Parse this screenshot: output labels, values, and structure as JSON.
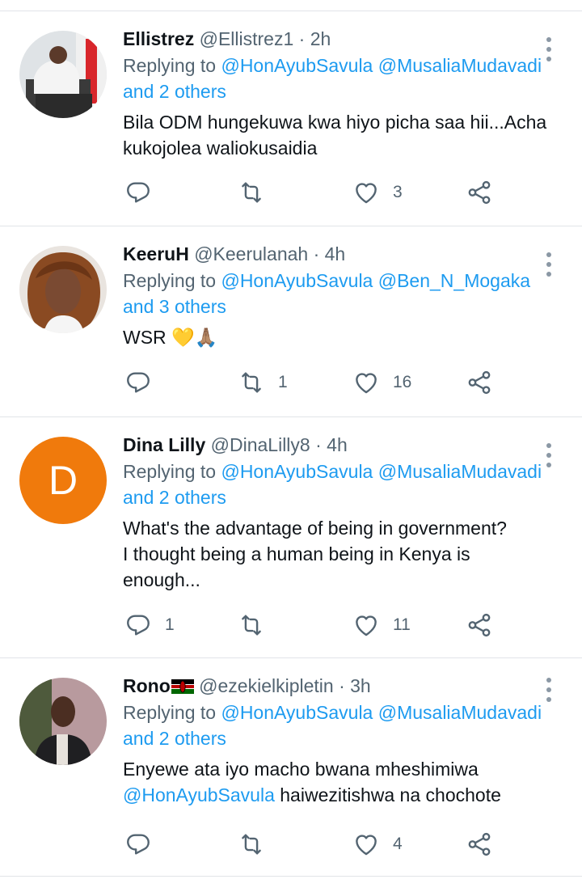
{
  "tweets": [
    {
      "name": "Ellistrez",
      "handle": "@Ellistrez1",
      "time": "· 2h",
      "reply_prefix": "Replying to",
      "mention1": "@HonAyubSavula",
      "mention2": "@MusaliaMudavadi",
      "others": "and 2 others",
      "text": "Bila ODM hungekuwa kwa hiyo picha saa hii...Acha kukojolea waliokusaidia",
      "replies": "",
      "retweets": "",
      "likes": "3"
    },
    {
      "name": "KeeruH",
      "handle": "@Keerulanah",
      "time": "· 4h",
      "reply_prefix": "Replying to",
      "mention1": "@HonAyubSavula",
      "mention2": "@Ben_N_Mogaka",
      "others": "and 3 others",
      "text": "WSR 💛🙏🏽",
      "replies": "",
      "retweets": "1",
      "likes": "16"
    },
    {
      "name": "Dina Lilly",
      "handle": "@DinaLilly8",
      "time": "· 4h",
      "avatar_letter": "D",
      "reply_prefix": "Replying to",
      "mention1": "@HonAyubSavula",
      "mention2": "@MusaliaMudavadi",
      "others": "and 2 others",
      "text_line1": "What's the advantage of being in government?",
      "text_line2": "I thought being a human being in Kenya is",
      "text_line3": "enough...",
      "replies": "1",
      "retweets": "",
      "likes": "11"
    },
    {
      "name": "Rono",
      "handle": "@ezekielkipletin",
      "time": "· 3h",
      "reply_prefix": "Replying to",
      "mention1": "@HonAyubSavula",
      "mention2": "@MusaliaMudavadi",
      "others": "and 2 others",
      "text_line1": "Enyewe ata iyo macho bwana mheshimiwa",
      "text_mention": "@HonAyubSavula",
      "text_rest": " haiwezitishwa na chochote",
      "replies": "",
      "retweets": "",
      "likes": "4"
    }
  ],
  "icons": {
    "reply": "reply-icon",
    "retweet": "retweet-icon",
    "like": "heart-icon",
    "share": "share-icon",
    "more": "more-vertical-icon"
  },
  "colors": {
    "link": "#1d9bf0",
    "meta": "#536471",
    "avatar_d": "#f07a0c"
  }
}
